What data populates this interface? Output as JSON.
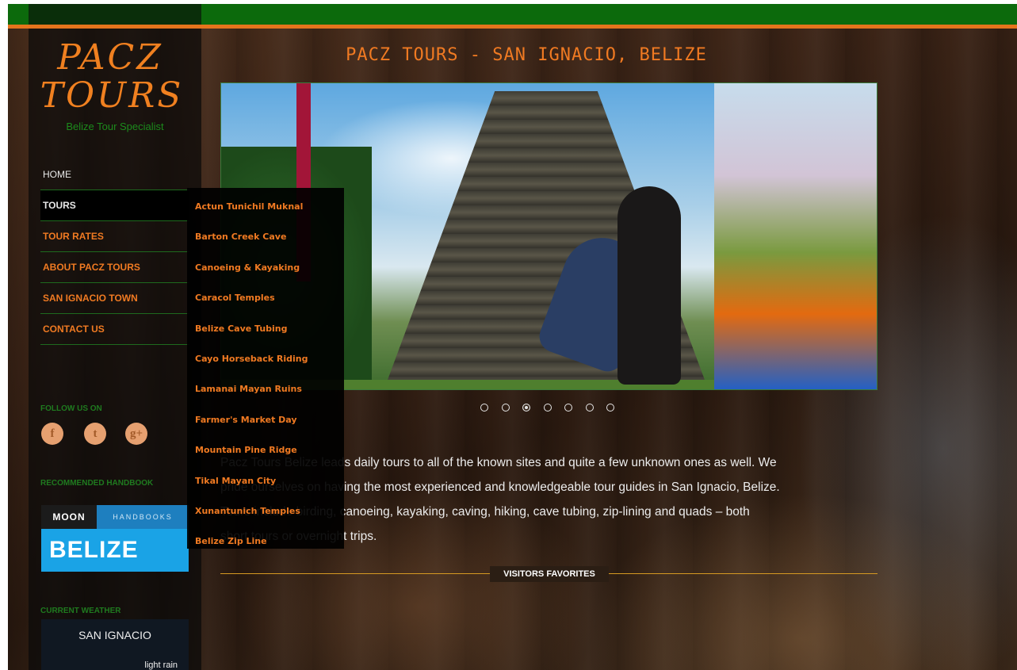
{
  "site": {
    "logo_line1": "PACZ",
    "logo_line2": "TOURS",
    "tagline": "Belize Tour Specialist",
    "page_title": "PACZ TOURS - SAN IGNACIO, BELIZE"
  },
  "nav": {
    "items": [
      {
        "label": "HOME"
      },
      {
        "label": "TOURS"
      },
      {
        "label": "TOUR RATES"
      },
      {
        "label": "ABOUT PACZ TOURS"
      },
      {
        "label": "SAN IGNACIO TOWN"
      },
      {
        "label": "CONTACT US"
      }
    ]
  },
  "tours_dropdown": [
    "Actun Tunichil Muknal",
    "Barton Creek Cave",
    "Canoeing & Kayaking",
    "Caracol Temples",
    "Belize Cave Tubing",
    "Cayo Horseback Riding",
    "Lamanai Mayan Ruins",
    "Farmer's Market Day",
    "Mountain Pine Ridge",
    "Tikal Mayan City",
    "Xunantunich Temples",
    "Belize Zip Line"
  ],
  "sidebar": {
    "follow_heading": "FOLLOW US ON",
    "social": [
      {
        "icon": "facebook-icon",
        "glyph": "f"
      },
      {
        "icon": "twitter-icon",
        "glyph": "t"
      },
      {
        "icon": "google-plus-icon",
        "glyph": "g+"
      }
    ],
    "handbook_heading": "RECOMMENDED HANDBOOK",
    "handbook": {
      "brand": "MOON",
      "series": "HANDBOOKS",
      "title": "BELIZE"
    },
    "weather_heading": "CURRENT WEATHER",
    "weather": {
      "city": "SAN IGNACIO",
      "condition": "light rain"
    }
  },
  "slider": {
    "slide_count": 7,
    "active_slide": 3
  },
  "main": {
    "intro_line1": "Pacz Tours Belize leads daily tours to all of the known sites and quite a few unknown ones as well. We",
    "intro_line2": "pride ourselves on having the most experienced and knowledgeable tour guides in San Ignacio, Belize.",
    "intro_line3": "Tours include birding, canoeing, kayaking, caving, hiking, cave tubing, zip-lining and quads – both",
    "intro_line4": "short tours or overnight trips.",
    "favorites_label": "VISITORS FAVORITES"
  },
  "colors": {
    "accent_orange": "#f07a22",
    "top_green": "#0c6a0c",
    "divider_green": "#1e6a1e"
  }
}
